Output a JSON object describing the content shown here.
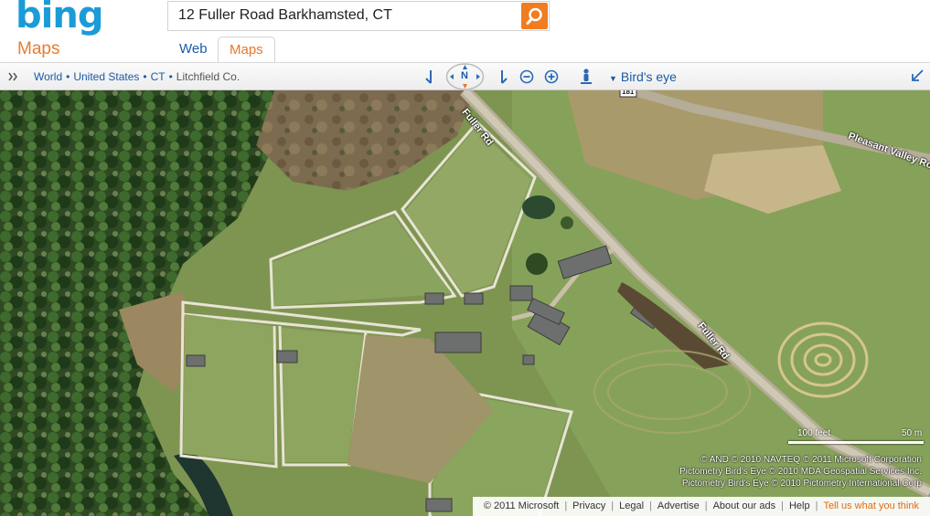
{
  "header": {
    "logo": "bing",
    "product": "Maps",
    "search_value": "12 Fuller Road Barkhamsted, CT",
    "search_icon": "search-icon",
    "tabs": [
      {
        "label": "Web",
        "active": false
      },
      {
        "label": "Maps",
        "active": true
      }
    ]
  },
  "toolbar": {
    "expand_icon": "double-chevron-right-icon",
    "breadcrumb": [
      "World",
      "United States",
      "CT",
      "Litchfield Co."
    ],
    "compass_label": "N",
    "view_mode": "Bird's eye",
    "collapse_icon": "arrow-down-left-icon"
  },
  "map": {
    "road_labels": [
      "Fuller Rd",
      "Pleasant Valley Ro",
      "Fuller Rd"
    ],
    "route_marker": "181",
    "scale": {
      "feet": "100 feet",
      "meters": "50 m"
    },
    "copyright": [
      "© AND  © 2010 NAVTEQ  © 2011 Microsoft Corporation",
      "Pictometry Bird's Eye © 2010 MDA Geospatial Services Inc.",
      "Pictometry Bird's Eye © 2010 Pictometry International Corp"
    ]
  },
  "footer": {
    "links": [
      "© 2011 Microsoft",
      "Privacy",
      "Legal",
      "Advertise",
      "About our ads",
      "Help"
    ],
    "feedback": "Tell us what you think"
  },
  "colors": {
    "brand_blue": "#1b9bd7",
    "accent_orange": "#f07d1f",
    "link_blue": "#1a5aa8"
  }
}
